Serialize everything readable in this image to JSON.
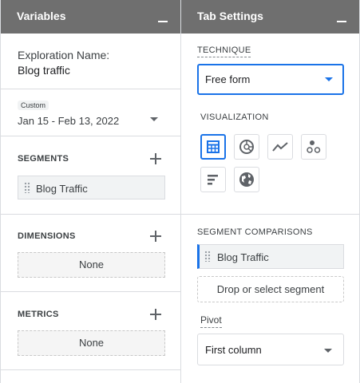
{
  "variables": {
    "title": "Variables",
    "exploration_label": "Exploration Name:",
    "exploration_name": "Blog traffic",
    "date_badge": "Custom",
    "date_range": "Jan 15 - Feb 13, 2022",
    "segments": {
      "title": "SEGMENTS",
      "items": [
        "Blog Traffic"
      ]
    },
    "dimensions": {
      "title": "DIMENSIONS",
      "empty": "None"
    },
    "metrics": {
      "title": "METRICS",
      "empty": "None"
    }
  },
  "tab_settings": {
    "title": "Tab Settings",
    "technique_label": "TECHNIQUE",
    "technique_value": "Free form",
    "visualization_label": "VISUALIZATION",
    "visualizations": [
      "table-icon",
      "donut-chart-icon",
      "line-chart-icon",
      "scatter-plot-icon",
      "bar-chart-icon",
      "globe-icon"
    ],
    "selected_visualization": "table-icon",
    "segment_comparisons_label": "SEGMENT COMPARISONS",
    "segment_comparisons": [
      "Blog Traffic"
    ],
    "drop_segment_label": "Drop or select segment",
    "pivot_label": "Pivot",
    "pivot_value": "First column"
  },
  "colors": {
    "header_bg": "#6f6f6f",
    "accent": "#1a73e8"
  }
}
